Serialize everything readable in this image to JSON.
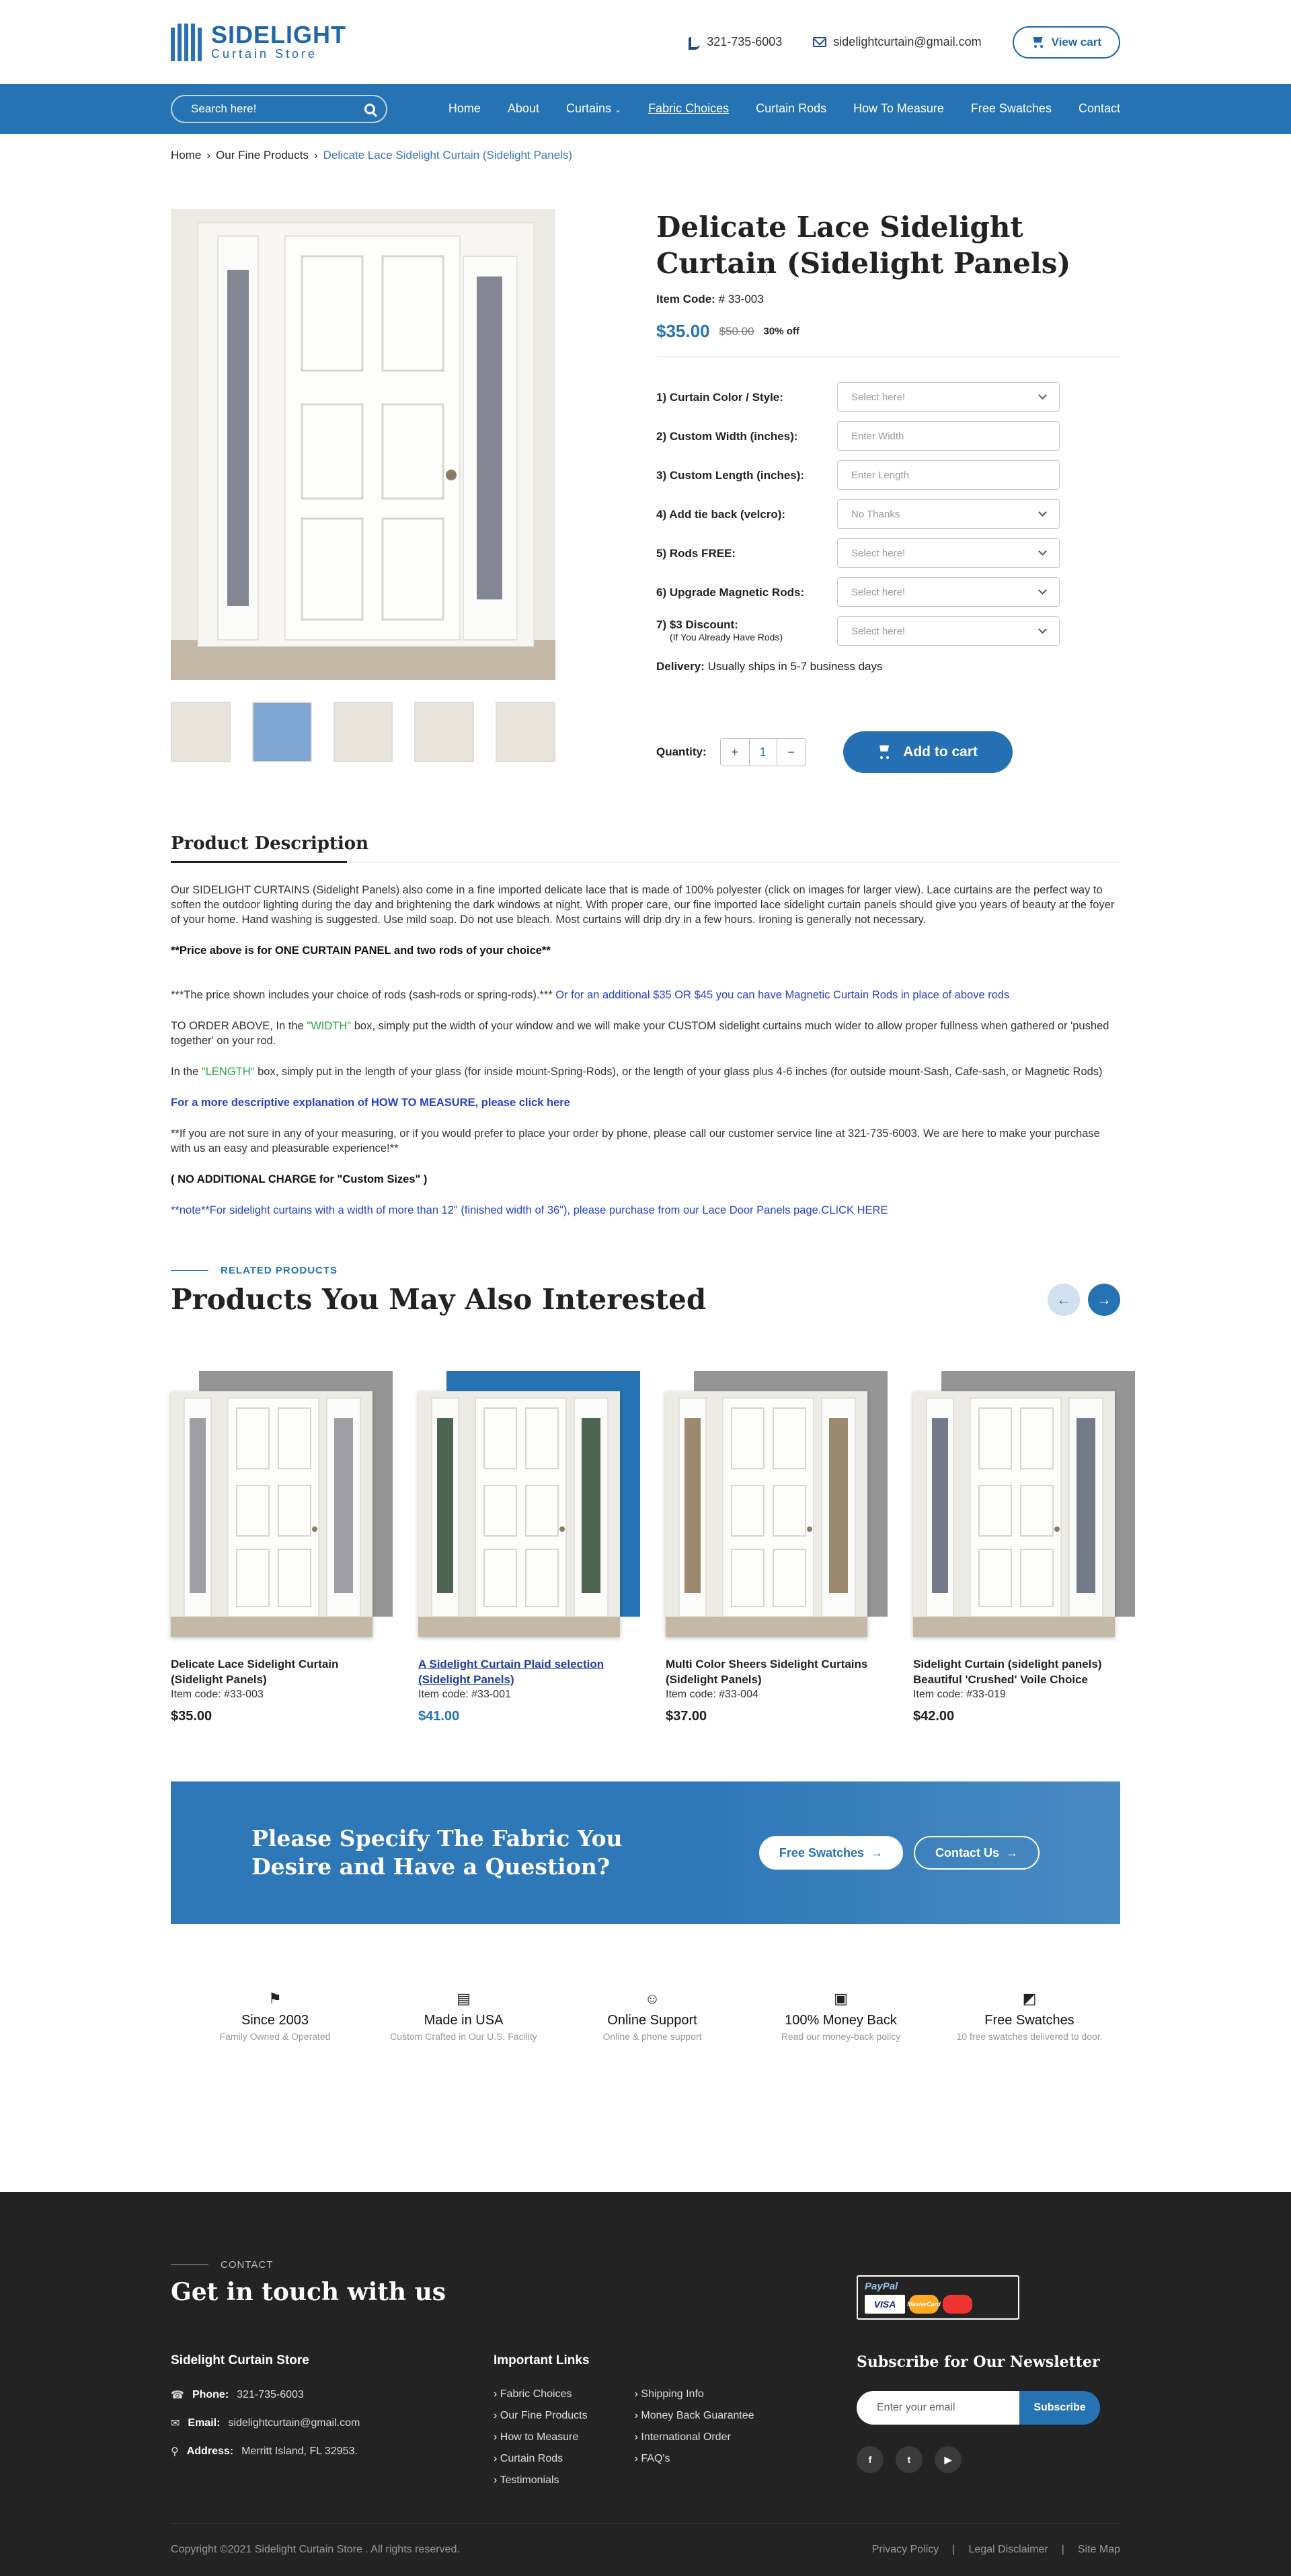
{
  "header": {
    "logo_title": "SIDELIGHT",
    "logo_subtitle": "Curtain Store",
    "phone": "321-735-6003",
    "email": "sidelightcurtain@gmail.com",
    "view_cart": "View cart",
    "accent": "#2673b3"
  },
  "nav": {
    "search_placeholder": "Search here!",
    "items": [
      "Home",
      "About",
      "Curtains",
      "Fabric Choices",
      "Curtain Rods",
      "How To Measure",
      "Free Swatches",
      "Contact"
    ]
  },
  "breadcrumb": [
    "Home",
    "Our Fine Products",
    "Delicate Lace Sidelight Curtain (Sidelight Panels)"
  ],
  "product": {
    "title": "Delicate Lace Sidelight Curtain (Sidelight Panels)",
    "item_code_label": "Item Code:",
    "item_code": "# 33-003",
    "price": "$35.00",
    "old_price": "$50.00",
    "discount": "30% off",
    "options": [
      {
        "label": "1) Curtain Color / Style:",
        "note": "",
        "value": "Select here!",
        "dropdown": true
      },
      {
        "label": "2) Custom Width (inches):",
        "note": "",
        "value": "Enter Width",
        "dropdown": false
      },
      {
        "label": "3) Custom Length (inches):",
        "note": "",
        "value": "Enter Length",
        "dropdown": false
      },
      {
        "label": "4) Add tie back (velcro):",
        "note": "",
        "value": "No Thanks",
        "dropdown": true
      },
      {
        "label": "5) Rods FREE:",
        "note": "",
        "value": "Select here!",
        "dropdown": true
      },
      {
        "label": "6) Upgrade Magnetic Rods:",
        "note": "",
        "value": "Select here!",
        "dropdown": true
      },
      {
        "label": "7) $3 Discount:",
        "note": "(If You Already Have Rods)",
        "value": "Select here!",
        "dropdown": true
      }
    ],
    "delivery_label": "Delivery:",
    "delivery_text": "Usually ships in 5-7 business days",
    "quantity_label": "Quantity:",
    "quantity": "1",
    "add_to_cart": "Add to cart"
  },
  "description": {
    "heading": "Product Description",
    "p1": "Our SIDELIGHT CURTAINS (Sidelight Panels) also come in a fine imported delicate lace that is made of 100% polyester (click on images for larger view). Lace curtains are the perfect way to soften the outdoor lighting during the day and brightening the dark windows at night. With proper care, our fine imported lace sidelight curtain panels should give you years of beauty at the foyer of your home. Hand washing is suggested. Use mild soap. Do not use bleach. Most curtains will drip dry in a few hours. Ironing is generally not necessary.",
    "p2": "**Price above is for ONE CURTAIN PANEL and two rods of your choice**",
    "p3a": "***The price shown includes your choice of rods (sash-rods or spring-rods).***",
    "p3b": " Or for an additional $35 OR $45 you can have Magnetic Curtain Rods in place of above rods",
    "p4a": "TO ORDER ABOVE, In the ",
    "p4b": "\"WIDTH\"",
    "p4c": " box, simply put the width of your window and we will make your CUSTOM sidelight curtains much wider to allow proper fullness when gathered or 'pushed together' on your rod.",
    "p5a": "In the ",
    "p5b": "\"LENGTH\"",
    "p5c": " box, simply put in the length of your glass (for inside mount-Spring-Rods), or the length of your glass plus 4-6 inches (for outside mount-Sash, Cafe-sash, or Magnetic Rods)",
    "p6": "For a more descriptive explanation of HOW TO MEASURE, please click here",
    "p7": "**If you are not sure in any of your measuring, or if you would prefer to place your order by phone, please call our customer service line at 321-735-6003. We are here to make your purchase with us an easy and pleasurable experience!**",
    "p8": "( NO ADDITIONAL CHARGE for \"Custom Sizes\" )",
    "p9": "**note**For sidelight curtains with a width of more than 12\" (finished width of 36\"), please purchase from our Lace Door Panels page.CLICK HERE"
  },
  "related": {
    "tag": "RELATED PRODUCTS",
    "title": "Products You May Also Interested",
    "items": [
      {
        "name": "Delicate Lace Sidelight Curtain (Sidelight Panels)",
        "code": "Item code: #33-003",
        "price": "$35.00",
        "curtain": "#8d8d95"
      },
      {
        "name": "A Sidelight Curtain Plaid selection (Sidelight Panels)",
        "code": "Item code: #33-001",
        "price": "$41.00",
        "curtain": "#2e4a32"
      },
      {
        "name": "Multi Color Sheers Sidelight Curtains (Sidelight Panels)",
        "code": "Item code: #33-004",
        "price": "$37.00",
        "curtain": "#8a7458"
      },
      {
        "name": "Sidelight Curtain (sidelight panels) Beautiful 'Crushed' Voile Choice",
        "code": "Item code: #33-019",
        "price": "$42.00",
        "curtain": "#5d6376"
      }
    ]
  },
  "banner": {
    "title": "Please Specify The Fabric You Desire and Have a Question?",
    "btn1": "Free Swatches",
    "btn2": "Contact Us"
  },
  "features": [
    {
      "title": "Since 2003",
      "sub": "Family Owned & Operated",
      "icon": "flag-icon"
    },
    {
      "title": "Made in USA",
      "sub": "Custom Crafted in Our U.S. Facility",
      "icon": "usa-flag-icon"
    },
    {
      "title": "Online Support",
      "sub": "Online & phone support",
      "icon": "support-icon"
    },
    {
      "title": "100% Money Back",
      "sub": "Read our money-back policy",
      "icon": "money-icon"
    },
    {
      "title": "Free Swatches",
      "sub": "10 free swatches delivered to door.",
      "icon": "swatch-icon"
    }
  ],
  "footer": {
    "contact_tag": "CONTACT",
    "contact_title": "Get in touch with us",
    "store_name": "Sidelight Curtain Store",
    "phone_label": "Phone:",
    "phone": "321-735-6003",
    "email_label": "Email:",
    "email": "sidelightcurtain@gmail.com",
    "address_label": "Address:",
    "address": "Merritt Island, FL 32953.",
    "links_title": "Important Links",
    "links_col1": [
      "Fabric Choices",
      "Our Fine Products",
      "How to Measure",
      "Curtain Rods",
      "Testimonials"
    ],
    "links_col2": [
      "Shipping Info",
      "Money Back Guarantee",
      "International Order",
      "FAQ's"
    ],
    "paypal": "PayPal",
    "visa": "VISA",
    "mastercard": "MasterCard",
    "newsletter_title": "Subscribe for Our Newsletter",
    "newsletter_placeholder": "Enter your email",
    "subscribe": "Subscribe",
    "social": [
      "f",
      "t",
      "▶"
    ],
    "copyright": "Copyright ©2021 Sidelight Curtain Store . All rights reserved.",
    "legal": [
      "Privacy Policy",
      "Legal Disclaimer",
      "Site Map"
    ]
  }
}
